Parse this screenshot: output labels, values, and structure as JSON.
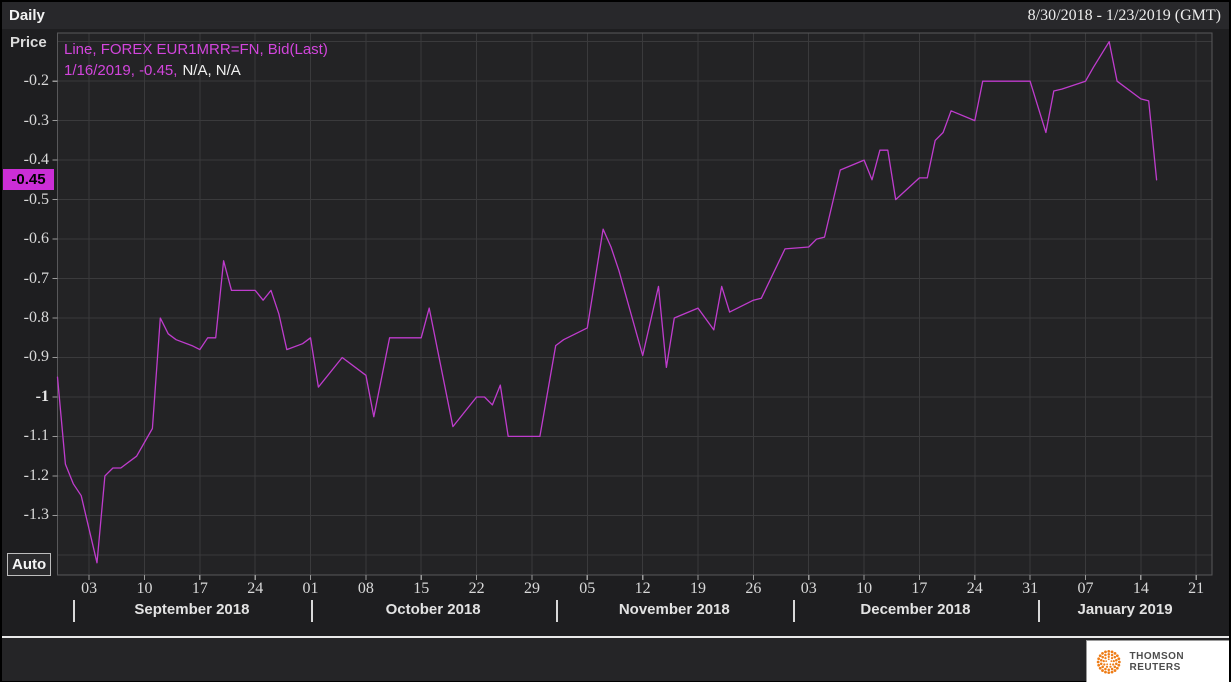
{
  "header": {
    "timeframe": "Daily",
    "range": "8/30/2018 - 1/23/2019 (GMT)"
  },
  "y_axis": {
    "title": "Price",
    "auto_label": "Auto",
    "current_badge": "-0.45"
  },
  "legend": {
    "line1": "Line, FOREX EUR1MRR=FN, Bid(Last)",
    "line2_highlight": "1/16/2019, -0.45,",
    "line2_rest": "N/A, N/A"
  },
  "footer": {
    "logo_text": "THOMSON REUTERS"
  },
  "colors": {
    "panel_bg": "#1e1e20",
    "header_bg": "#28282b",
    "plot_bg": "#232325",
    "strip_bg": "#252527",
    "grid": "#3a3a3c",
    "frame": "#58585a",
    "tick": "#9a9a9a",
    "tick_text": "#d9d9d9",
    "line": "#bf3ccd",
    "magenta": "#d245dc",
    "badge_bg": "#cb2ed6",
    "logo_orange": "#ee7d18"
  },
  "chart_data": {
    "type": "line",
    "title": "FOREX EUR1MRR=FN, Bid(Last), Daily, 8/30/2018 - 1/23/2019 (GMT)",
    "series_name": "FOREX EUR1MRR=FN Bid(Last)",
    "ylabel": "Price",
    "grid": true,
    "legend_position": "top-left",
    "x_domain": [
      "2018-08-30",
      "2019-01-23"
    ],
    "y_domain_top": -0.078,
    "y_domain_bottom": -1.451,
    "y_gridlines": [
      -0.1,
      -0.2,
      -0.3,
      -0.4,
      -0.5,
      -0.6,
      -0.7,
      -0.8,
      -0.9,
      -1.0,
      -1.1,
      -1.2,
      -1.3,
      -1.4
    ],
    "y_ticks": [
      {
        "v": -0.2,
        "label": "-0.2"
      },
      {
        "v": -0.3,
        "label": "-0.3"
      },
      {
        "v": -0.4,
        "label": "-0.4"
      },
      {
        "v": -0.5,
        "label": "-0.5"
      },
      {
        "v": -0.6,
        "label": "-0.6"
      },
      {
        "v": -0.7,
        "label": "-0.7"
      },
      {
        "v": -0.8,
        "label": "-0.8"
      },
      {
        "v": -0.9,
        "label": "-0.9"
      },
      {
        "v": -1.0,
        "label": "-1",
        "bold": true
      },
      {
        "v": -1.1,
        "label": "-1.1"
      },
      {
        "v": -1.2,
        "label": "-1.2"
      },
      {
        "v": -1.3,
        "label": "-1.3"
      }
    ],
    "current": {
      "date": "2019-01-16",
      "v": -0.45
    },
    "x_ticks": [
      {
        "date": "2018-09-03",
        "label": "03"
      },
      {
        "date": "2018-09-10",
        "label": "10"
      },
      {
        "date": "2018-09-17",
        "label": "17"
      },
      {
        "date": "2018-09-24",
        "label": "24"
      },
      {
        "date": "2018-10-01",
        "label": "01"
      },
      {
        "date": "2018-10-08",
        "label": "08"
      },
      {
        "date": "2018-10-15",
        "label": "15"
      },
      {
        "date": "2018-10-22",
        "label": "22"
      },
      {
        "date": "2018-10-29",
        "label": "29"
      },
      {
        "date": "2018-11-05",
        "label": "05"
      },
      {
        "date": "2018-11-12",
        "label": "12"
      },
      {
        "date": "2018-11-19",
        "label": "19"
      },
      {
        "date": "2018-11-26",
        "label": "26"
      },
      {
        "date": "2018-12-03",
        "label": "03"
      },
      {
        "date": "2018-12-10",
        "label": "10"
      },
      {
        "date": "2018-12-17",
        "label": "17"
      },
      {
        "date": "2018-12-24",
        "label": "24"
      },
      {
        "date": "2018-12-31",
        "label": "31"
      },
      {
        "date": "2019-01-07",
        "label": "07"
      },
      {
        "date": "2019-01-14",
        "label": "14"
      },
      {
        "date": "2019-01-21",
        "label": "21"
      }
    ],
    "months": [
      {
        "label": "September 2018",
        "start": "2018-09-01",
        "end": "2018-10-01"
      },
      {
        "label": "October 2018",
        "start": "2018-10-01",
        "end": "2018-11-01"
      },
      {
        "label": "November 2018",
        "start": "2018-11-01",
        "end": "2018-12-01"
      },
      {
        "label": "December 2018",
        "start": "2018-12-01",
        "end": "2019-01-01"
      },
      {
        "label": "January 2019",
        "start": "2019-01-01",
        "end": "2019-01-23"
      }
    ],
    "points": [
      [
        "2018-08-30",
        -0.95
      ],
      [
        "2018-08-31",
        -1.17
      ],
      [
        "2018-09-01",
        -1.22
      ],
      [
        "2018-09-02",
        -1.25
      ],
      [
        "2018-09-04",
        -1.42
      ],
      [
        "2018-09-05",
        -1.2
      ],
      [
        "2018-09-06",
        -1.18
      ],
      [
        "2018-09-07",
        -1.18
      ],
      [
        "2018-09-09",
        -1.15
      ],
      [
        "2018-09-11",
        -1.08
      ],
      [
        "2018-09-12",
        -0.8
      ],
      [
        "2018-09-13",
        -0.84
      ],
      [
        "2018-09-14",
        -0.855
      ],
      [
        "2018-09-16",
        -0.87
      ],
      [
        "2018-09-17",
        -0.88
      ],
      [
        "2018-09-18",
        -0.85
      ],
      [
        "2018-09-19",
        -0.85
      ],
      [
        "2018-09-20",
        -0.655
      ],
      [
        "2018-09-21",
        -0.73
      ],
      [
        "2018-09-24",
        -0.73
      ],
      [
        "2018-09-25",
        -0.755
      ],
      [
        "2018-09-26",
        -0.73
      ],
      [
        "2018-09-27",
        -0.79
      ],
      [
        "2018-09-28",
        -0.88
      ],
      [
        "2018-09-30",
        -0.865
      ],
      [
        "2018-10-01",
        -0.85
      ],
      [
        "2018-10-02",
        -0.975
      ],
      [
        "2018-10-05",
        -0.9
      ],
      [
        "2018-10-08",
        -0.945
      ],
      [
        "2018-10-09",
        -1.05
      ],
      [
        "2018-10-11",
        -0.85
      ],
      [
        "2018-10-15",
        -0.85
      ],
      [
        "2018-10-16",
        -0.775
      ],
      [
        "2018-10-19",
        -1.075
      ],
      [
        "2018-10-22",
        -1.0
      ],
      [
        "2018-10-23",
        -1.0
      ],
      [
        "2018-10-24",
        -1.02
      ],
      [
        "2018-10-25",
        -0.97
      ],
      [
        "2018-10-26",
        -1.1
      ],
      [
        "2018-10-30",
        -1.1
      ],
      [
        "2018-11-01",
        -0.87
      ],
      [
        "2018-11-02",
        -0.855
      ],
      [
        "2018-11-05",
        -0.825
      ],
      [
        "2018-11-07",
        -0.575
      ],
      [
        "2018-11-08",
        -0.62
      ],
      [
        "2018-11-09",
        -0.68
      ],
      [
        "2018-11-12",
        -0.895
      ],
      [
        "2018-11-14",
        -0.72
      ],
      [
        "2018-11-15",
        -0.925
      ],
      [
        "2018-11-16",
        -0.8
      ],
      [
        "2018-11-19",
        -0.775
      ],
      [
        "2018-11-21",
        -0.83
      ],
      [
        "2018-11-22",
        -0.72
      ],
      [
        "2018-11-23",
        -0.785
      ],
      [
        "2018-11-26",
        -0.755
      ],
      [
        "2018-11-27",
        -0.75
      ],
      [
        "2018-11-30",
        -0.625
      ],
      [
        "2018-12-03",
        -0.62
      ],
      [
        "2018-12-04",
        -0.6
      ],
      [
        "2018-12-05",
        -0.595
      ],
      [
        "2018-12-06",
        -0.51
      ],
      [
        "2018-12-07",
        -0.425
      ],
      [
        "2018-12-10",
        -0.4
      ],
      [
        "2018-12-11",
        -0.45
      ],
      [
        "2018-12-12",
        -0.375
      ],
      [
        "2018-12-13",
        -0.375
      ],
      [
        "2018-12-14",
        -0.5
      ],
      [
        "2018-12-17",
        -0.445
      ],
      [
        "2018-12-18",
        -0.445
      ],
      [
        "2018-12-19",
        -0.35
      ],
      [
        "2018-12-20",
        -0.33
      ],
      [
        "2018-12-21",
        -0.275
      ],
      [
        "2018-12-24",
        -0.3
      ],
      [
        "2018-12-25",
        -0.2
      ],
      [
        "2018-12-31",
        -0.2
      ],
      [
        "2019-01-02",
        -0.33
      ],
      [
        "2019-01-03",
        -0.225
      ],
      [
        "2019-01-04",
        -0.22
      ],
      [
        "2019-01-07",
        -0.2
      ],
      [
        "2019-01-08",
        -0.165
      ],
      [
        "2019-01-10",
        -0.1
      ],
      [
        "2019-01-11",
        -0.2
      ],
      [
        "2019-01-14",
        -0.245
      ],
      [
        "2019-01-15",
        -0.25
      ],
      [
        "2019-01-16",
        -0.45
      ]
    ]
  }
}
